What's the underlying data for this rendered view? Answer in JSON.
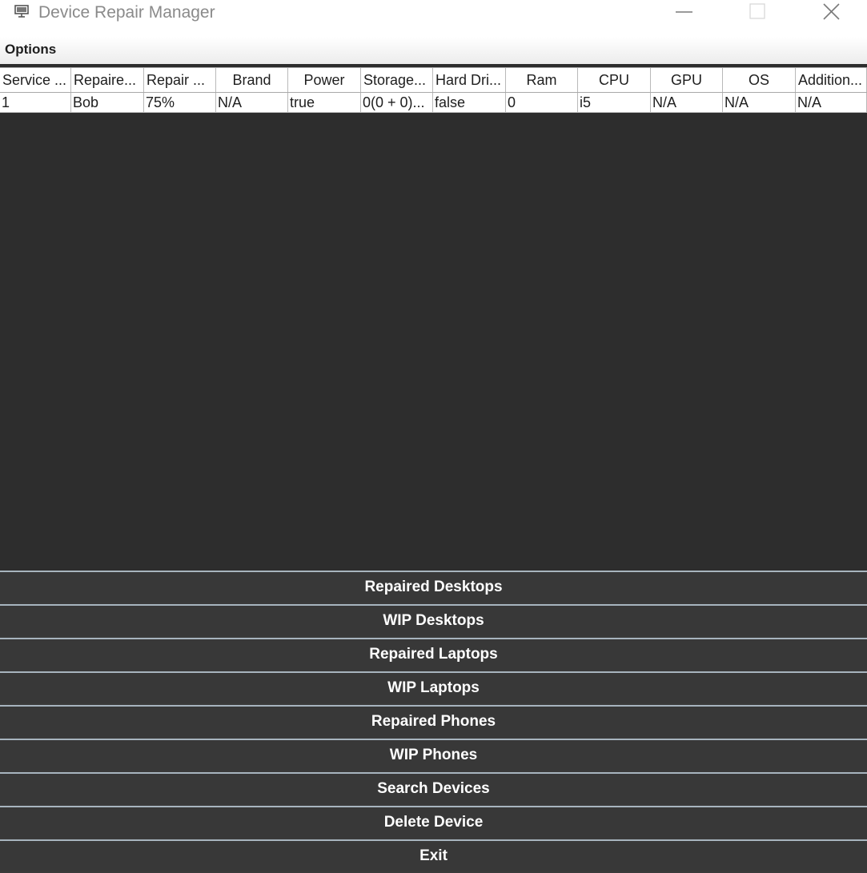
{
  "window": {
    "title": "Device Repair Manager",
    "icon": "monitor-icon"
  },
  "menu": {
    "options_label": "Options"
  },
  "table": {
    "headers": [
      "Service ...",
      "Repaire...",
      "Repair ...",
      "Brand",
      "Power",
      "Storage...",
      "Hard Dri...",
      "Ram",
      "CPU",
      "GPU",
      "OS",
      "Addition..."
    ],
    "rows": [
      [
        "1",
        "Bob",
        "75%",
        "N/A",
        "true",
        "0(0 + 0)...",
        "false",
        "0",
        "i5",
        "N/A",
        "N/A",
        "N/A"
      ]
    ]
  },
  "buttons": {
    "repaired_desktops": "Repaired Desktops",
    "wip_desktops": "WIP Desktops",
    "repaired_laptops": "Repaired Laptops",
    "wip_laptops": "WIP Laptops",
    "repaired_phones": "Repaired Phones",
    "wip_phones": "WIP Phones",
    "search_devices": "Search Devices",
    "delete_device": "Delete Device",
    "exit": "Exit"
  },
  "colors": {
    "table_background": "#2d2d2d",
    "button_background": "#383838",
    "button_border": "#a7b4be",
    "button_text": "#ffffff"
  }
}
